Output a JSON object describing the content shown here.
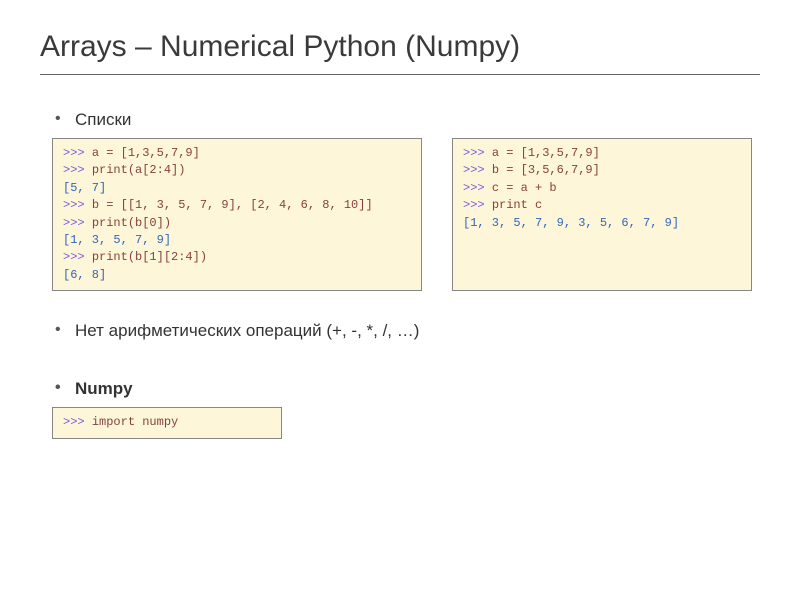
{
  "title": "Arrays – Numerical Python (Numpy)",
  "bullets": {
    "lists": "Списки",
    "noarith": "Нет арифметических операций (+, -, *, /, …)",
    "numpy": "Numpy"
  },
  "code": {
    "left": [
      {
        "p": ">>> ",
        "c": "a = [1,3,5,7,9]"
      },
      {
        "p": ">>> ",
        "c": "print(a[2:4])"
      },
      {
        "o": "[5, 7]"
      },
      {
        "p": ">>> ",
        "c": "b = [[1, 3, 5, 7, 9], [2, 4, 6, 8, 10]]"
      },
      {
        "p": ">>> ",
        "c": "print(b[0])"
      },
      {
        "o": "[1, 3, 5, 7, 9]"
      },
      {
        "p": ">>> ",
        "c": "print(b[1][2:4])"
      },
      {
        "o": "[6, 8]"
      }
    ],
    "right": [
      {
        "p": ">>> ",
        "c": "a = [1,3,5,7,9]"
      },
      {
        "p": ">>> ",
        "c": "b = [3,5,6,7,9]"
      },
      {
        "p": ">>> ",
        "c": "c = a + b"
      },
      {
        "p": ">>> ",
        "c": "print c"
      },
      {
        "o": "[1, 3, 5, 7, 9, 3, 5, 6, 7, 9]"
      }
    ],
    "import": [
      {
        "p": ">>> ",
        "c": "import numpy"
      }
    ]
  }
}
